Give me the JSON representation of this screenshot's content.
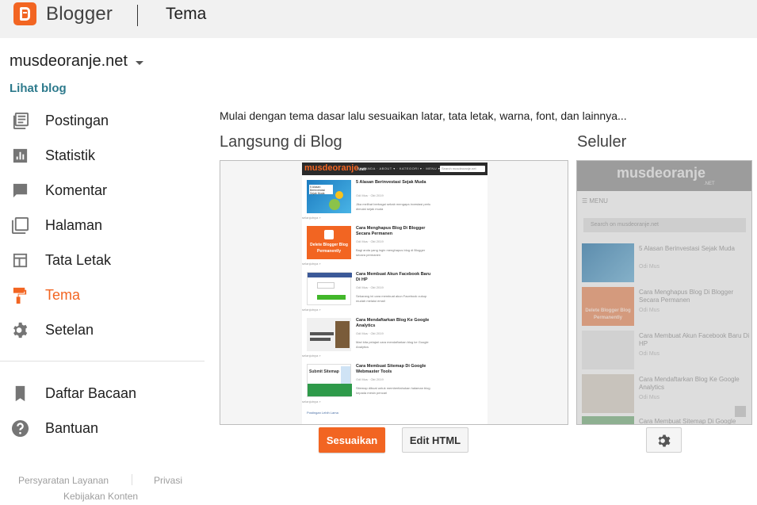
{
  "header": {
    "brand": "Blogger",
    "section_title": "Tema",
    "brand_color": "#f26522"
  },
  "sidebar": {
    "blog_name": "musdeoranje.net",
    "view_blog": "Lihat blog",
    "items": [
      {
        "label": "Postingan",
        "icon": "posts-icon"
      },
      {
        "label": "Statistik",
        "icon": "stats-icon"
      },
      {
        "label": "Komentar",
        "icon": "comment-icon"
      },
      {
        "label": "Halaman",
        "icon": "pages-icon"
      },
      {
        "label": "Tata Letak",
        "icon": "layout-icon"
      },
      {
        "label": "Tema",
        "icon": "paint-roller-icon",
        "active": true
      },
      {
        "label": "Setelan",
        "icon": "gear-icon"
      }
    ],
    "secondary_items": [
      {
        "label": "Daftar Bacaan",
        "icon": "bookmark-icon"
      },
      {
        "label": "Bantuan",
        "icon": "help-icon"
      }
    ],
    "footer": {
      "terms": "Persyaratan Layanan",
      "privacy": "Privasi",
      "content_policy": "Kebijakan Konten"
    }
  },
  "main": {
    "intro": "Mulai dengan tema dasar lalu sesuaikan latar, tata letak, warna, font, dan lainnya...",
    "desktop_title": "Langsung di Blog",
    "mobile_title": "Seluler",
    "customize_button": "Sesuaikan",
    "edit_html_button": "Edit HTML"
  },
  "preview": {
    "site_logo_a": "musdeoranje",
    "site_logo_b": ".net",
    "menu": "BERANDA · ABOUT ▾ · KATEGORI ▾ · MENU ▾",
    "search": "Search musdeoranje.net",
    "posts": [
      {
        "title": "5 Alasan Berinvestasi Sejak Muda",
        "meta": "Odi Mus · Okt 2019",
        "snippet": "Jika melihat berbagai sebab mengapa investasi perlu dimulai sejak muda",
        "more": "selanjutnya »"
      },
      {
        "title": "Cara Menghapus Blog Di Blogger Secara Permanen",
        "meta": "Odi Mus · Okt 2019",
        "snippet": "Bagi anda yang ingin menghapus blog di Blogger secara permanen",
        "more": "selanjutnya »"
      },
      {
        "title": "Cara Membuat Akun Facebook Baru Di HP",
        "meta": "Odi Mus · Okt 2019",
        "snippet": "Sekarang ini cara membuat akun Facebook cukup mudah melalui email",
        "more": "selanjutnya »"
      },
      {
        "title": "Cara Mendaftarkan Blog Ke Google Analytics",
        "meta": "Odi Mus · Okt 2019",
        "snippet": "Mari kita pelajari cara mendaftarkan blog ke Google Analytics",
        "more": "selanjutnya »"
      },
      {
        "title": "Cara Membuat Sitemap Di Google Webmaster Tools",
        "meta": "Odi Mus · Okt 2019",
        "snippet": "Sitemap dibuat untuk memberitahukan halaman blog kepada mesin pencari",
        "more": "selanjutnya »"
      }
    ],
    "next": "Postingan Lebih Lama",
    "mobile_logo": "musdeoranje",
    "mobile_logo_net": ".NET",
    "mobile_menu": "☰ MENU",
    "mobile_search": "Search on musdeoranje.net",
    "mobile_posts": [
      {
        "title": "5 Alasan Berinvestasi Sejak Muda",
        "meta": "Odi Mus"
      },
      {
        "title": "Cara Menghapus Blog Di Blogger Secara Permanen",
        "meta": "Odi Mus"
      },
      {
        "title": "Cara Membuat Akun Facebook Baru Di HP",
        "meta": "Odi Mus"
      },
      {
        "title": "Cara Mendaftarkan Blog Ke Google Analytics",
        "meta": "Odi Mus"
      },
      {
        "title": "Cara Membuat Sitemap Di Google",
        "meta": ""
      }
    ],
    "thumb_texts": [
      "5 Alasan Berinvestasi Sejak Muda",
      "Delete Blogger Blog Permanently",
      "",
      "",
      "Submit Sitemap"
    ]
  }
}
